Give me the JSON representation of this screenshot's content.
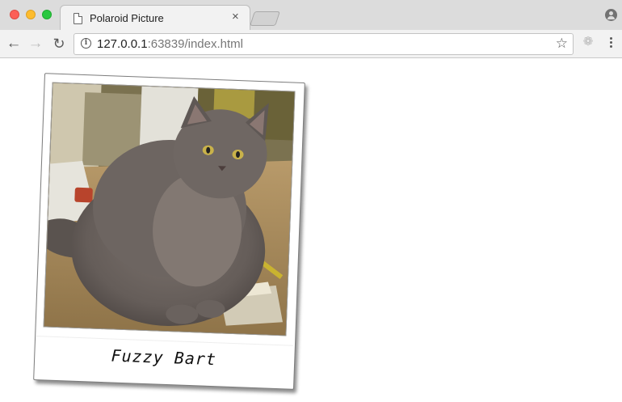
{
  "browser": {
    "tab_title": "Polaroid Picture",
    "tab_close": "×",
    "url_host": "127.0.0.1",
    "url_rest": ":63839/index.html",
    "back_glyph": "←",
    "forward_glyph": "→",
    "reload_glyph": "↻",
    "star_glyph": "☆",
    "ext_glyph": "❁"
  },
  "polaroid": {
    "caption": "Fuzzy Bart",
    "photo_subject": "grey long-haired cat sitting on a wooden table"
  },
  "colors": {
    "titlebar": "#dcdcdc",
    "toolbar": "#f2f2f2",
    "cat_fur": "#6e6662",
    "table": "#a88c5e",
    "eyes": "#c9b24a"
  }
}
